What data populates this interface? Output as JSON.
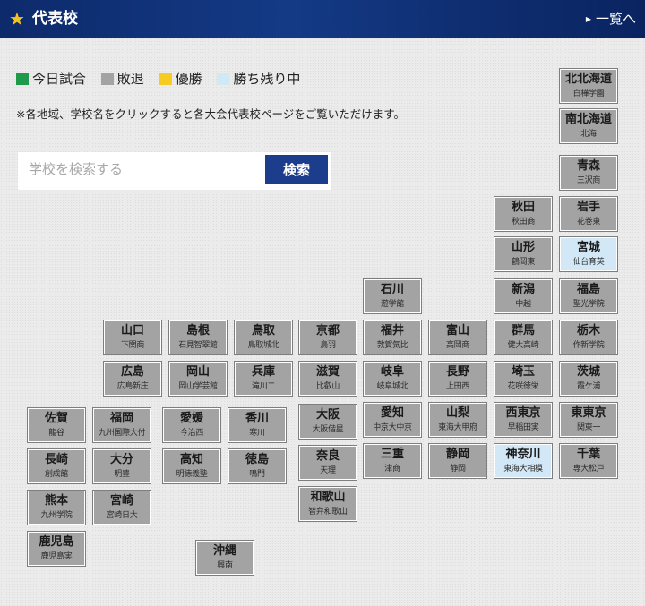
{
  "header": {
    "title": "代表校",
    "list_link": "一覧へ"
  },
  "legend": [
    {
      "label": "今日試合",
      "color": "#1f9a4a"
    },
    {
      "label": "敗退",
      "color": "#a3a3a3"
    },
    {
      "label": "優勝",
      "color": "#f5cb24"
    },
    {
      "label": "勝ち残り中",
      "color": "#d3e8f6"
    }
  ],
  "note": "※各地域、学校名をクリックすると各大会代表校ページをご覧いただけます。",
  "search": {
    "placeholder": "学校を検索する",
    "button_label": "検索"
  },
  "prefectures": [
    {
      "id": "kitahokkaido",
      "name": "北北海道",
      "school": "白樺学園",
      "status": "eliminated"
    },
    {
      "id": "minamihokkaido",
      "name": "南北海道",
      "school": "北海",
      "status": "eliminated"
    },
    {
      "id": "aomori",
      "name": "青森",
      "school": "三沢商",
      "status": "eliminated"
    },
    {
      "id": "akita",
      "name": "秋田",
      "school": "秋田商",
      "status": "eliminated"
    },
    {
      "id": "iwate",
      "name": "岩手",
      "school": "花巻東",
      "status": "eliminated"
    },
    {
      "id": "yamagata",
      "name": "山形",
      "school": "鶴岡東",
      "status": "eliminated"
    },
    {
      "id": "miyagi",
      "name": "宮城",
      "school": "仙台育英",
      "status": "remaining"
    },
    {
      "id": "ishikawa",
      "name": "石川",
      "school": "遊学館",
      "status": "eliminated"
    },
    {
      "id": "niigata",
      "name": "新潟",
      "school": "中越",
      "status": "eliminated"
    },
    {
      "id": "fukushima",
      "name": "福島",
      "school": "聖光学院",
      "status": "eliminated"
    },
    {
      "id": "yamaguchi",
      "name": "山口",
      "school": "下関商",
      "status": "eliminated"
    },
    {
      "id": "shimane",
      "name": "島根",
      "school": "石見智翠館",
      "status": "eliminated"
    },
    {
      "id": "tottori",
      "name": "鳥取",
      "school": "鳥取城北",
      "status": "eliminated"
    },
    {
      "id": "kyoto",
      "name": "京都",
      "school": "鳥羽",
      "status": "eliminated"
    },
    {
      "id": "fukui",
      "name": "福井",
      "school": "敦賀気比",
      "status": "eliminated"
    },
    {
      "id": "toyama",
      "name": "富山",
      "school": "高岡商",
      "status": "eliminated"
    },
    {
      "id": "gunma",
      "name": "群馬",
      "school": "健大高崎",
      "status": "eliminated"
    },
    {
      "id": "tochigi",
      "name": "栃木",
      "school": "作新学院",
      "status": "eliminated"
    },
    {
      "id": "hiroshima",
      "name": "広島",
      "school": "広島新庄",
      "status": "eliminated"
    },
    {
      "id": "okayama",
      "name": "岡山",
      "school": "岡山学芸館",
      "status": "eliminated"
    },
    {
      "id": "hyogo",
      "name": "兵庫",
      "school": "滝川二",
      "status": "eliminated"
    },
    {
      "id": "shiga",
      "name": "滋賀",
      "school": "比叡山",
      "status": "eliminated"
    },
    {
      "id": "gifu",
      "name": "岐阜",
      "school": "岐阜城北",
      "status": "eliminated"
    },
    {
      "id": "nagano",
      "name": "長野",
      "school": "上田西",
      "status": "eliminated"
    },
    {
      "id": "saitama",
      "name": "埼玉",
      "school": "花咲徳栄",
      "status": "eliminated"
    },
    {
      "id": "ibaraki",
      "name": "茨城",
      "school": "霞ケ浦",
      "status": "eliminated"
    },
    {
      "id": "saga",
      "name": "佐賀",
      "school": "龍谷",
      "status": "eliminated"
    },
    {
      "id": "fukuoka",
      "name": "福岡",
      "school": "九州国際大付",
      "status": "eliminated"
    },
    {
      "id": "ehime",
      "name": "愛媛",
      "school": "今治西",
      "status": "eliminated"
    },
    {
      "id": "kagawa",
      "name": "香川",
      "school": "寒川",
      "status": "eliminated"
    },
    {
      "id": "osaka",
      "name": "大阪",
      "school": "大阪偕星",
      "status": "eliminated"
    },
    {
      "id": "aichi",
      "name": "愛知",
      "school": "中京大中京",
      "status": "eliminated"
    },
    {
      "id": "yamanashi",
      "name": "山梨",
      "school": "東海大甲府",
      "status": "eliminated"
    },
    {
      "id": "nishitokyo",
      "name": "西東京",
      "school": "早稲田実",
      "status": "eliminated"
    },
    {
      "id": "higashitokyo",
      "name": "東東京",
      "school": "関東一",
      "status": "eliminated"
    },
    {
      "id": "nagasaki",
      "name": "長崎",
      "school": "創成館",
      "status": "eliminated"
    },
    {
      "id": "oita",
      "name": "大分",
      "school": "明豊",
      "status": "eliminated"
    },
    {
      "id": "kochi",
      "name": "高知",
      "school": "明徳義塾",
      "status": "eliminated"
    },
    {
      "id": "tokushima",
      "name": "徳島",
      "school": "鳴門",
      "status": "eliminated"
    },
    {
      "id": "nara",
      "name": "奈良",
      "school": "天理",
      "status": "eliminated"
    },
    {
      "id": "mie",
      "name": "三重",
      "school": "津商",
      "status": "eliminated"
    },
    {
      "id": "shizuoka",
      "name": "静岡",
      "school": "静岡",
      "status": "eliminated"
    },
    {
      "id": "kanagawa",
      "name": "神奈川",
      "school": "東海大相模",
      "status": "remaining"
    },
    {
      "id": "chiba",
      "name": "千葉",
      "school": "専大松戸",
      "status": "eliminated"
    },
    {
      "id": "kumamoto",
      "name": "熊本",
      "school": "九州学院",
      "status": "eliminated"
    },
    {
      "id": "miyazaki",
      "name": "宮崎",
      "school": "宮崎日大",
      "status": "eliminated"
    },
    {
      "id": "wakayama",
      "name": "和歌山",
      "school": "智弁和歌山",
      "status": "eliminated"
    },
    {
      "id": "kagoshima",
      "name": "鹿児島",
      "school": "鹿児島実",
      "status": "eliminated"
    },
    {
      "id": "okinawa",
      "name": "沖縄",
      "school": "興南",
      "status": "eliminated"
    }
  ]
}
